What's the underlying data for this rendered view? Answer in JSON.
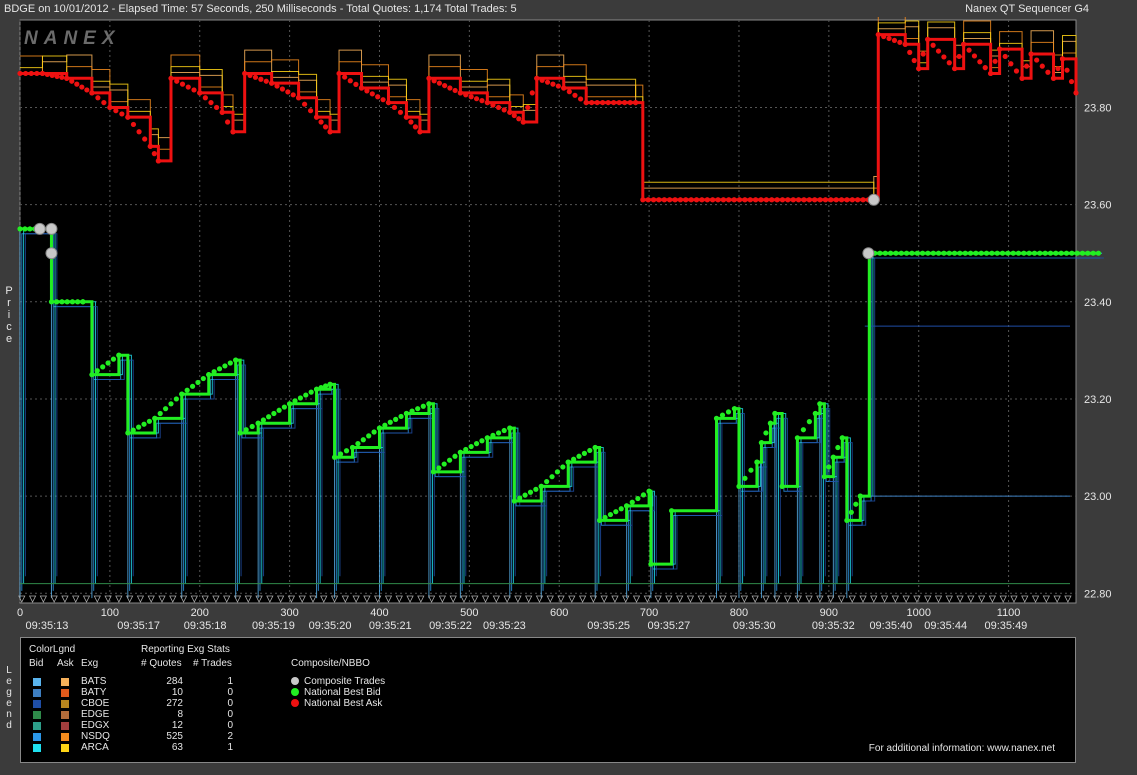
{
  "header": {
    "left": "BDGE on 10/01/2012  -  Elapsed Time: 57 Seconds, 250 Milliseconds  -  Total Quotes: 1,174  Total Trades: 5",
    "right": "Nanex QT Sequencer G4"
  },
  "watermark": "NANEX",
  "y_axis_title": "Price",
  "legend_axis_title": "Legend",
  "chart_data": {
    "type": "line",
    "xlim": [
      0,
      1175
    ],
    "ylim": [
      22.78,
      23.98
    ],
    "x_ticks": [
      0,
      100,
      200,
      300,
      400,
      500,
      600,
      700,
      800,
      900,
      1000,
      1100
    ],
    "y_ticks": [
      22.8,
      23.0,
      23.2,
      23.4,
      23.6,
      23.8
    ],
    "y_tick_labels": [
      "22.80",
      "23.00",
      "23.20",
      "23.40",
      "23.60",
      "23.80"
    ],
    "time_labels": [
      {
        "x": 30,
        "label": "09:35:13"
      },
      {
        "x": 132,
        "label": "09:35:17"
      },
      {
        "x": 206,
        "label": "09:35:18"
      },
      {
        "x": 282,
        "label": "09:35:19"
      },
      {
        "x": 345,
        "label": "09:35:20"
      },
      {
        "x": 412,
        "label": "09:35:21"
      },
      {
        "x": 479,
        "label": "09:35:22"
      },
      {
        "x": 539,
        "label": "09:35:23"
      },
      {
        "x": 655,
        "label": "09:35:25"
      },
      {
        "x": 722,
        "label": "09:35:27"
      },
      {
        "x": 817,
        "label": "09:35:30"
      },
      {
        "x": 905,
        "label": "09:35:32"
      },
      {
        "x": 969,
        "label": "09:35:40"
      },
      {
        "x": 1030,
        "label": "09:35:44"
      },
      {
        "x": 1097,
        "label": "09:35:49"
      }
    ],
    "grid": true,
    "national_best_ask": [
      [
        0,
        23.87
      ],
      [
        25,
        23.87
      ],
      [
        52,
        23.86
      ],
      [
        80,
        23.83
      ],
      [
        100,
        23.8
      ],
      [
        120,
        23.78
      ],
      [
        145,
        23.72
      ],
      [
        154,
        23.69
      ],
      [
        168,
        23.86
      ],
      [
        200,
        23.83
      ],
      [
        225,
        23.79
      ],
      [
        237,
        23.75
      ],
      [
        250,
        23.87
      ],
      [
        280,
        23.85
      ],
      [
        310,
        23.82
      ],
      [
        330,
        23.78
      ],
      [
        345,
        23.75
      ],
      [
        355,
        23.87
      ],
      [
        380,
        23.84
      ],
      [
        410,
        23.81
      ],
      [
        430,
        23.78
      ],
      [
        445,
        23.75
      ],
      [
        455,
        23.86
      ],
      [
        490,
        23.83
      ],
      [
        520,
        23.81
      ],
      [
        545,
        23.79
      ],
      [
        560,
        23.77
      ],
      [
        575,
        23.86
      ],
      [
        605,
        23.84
      ],
      [
        630,
        23.81
      ],
      [
        685,
        23.81
      ],
      [
        693,
        23.61
      ],
      [
        950,
        23.61
      ],
      [
        955,
        23.95
      ],
      [
        985,
        23.93
      ],
      [
        1000,
        23.88
      ],
      [
        1010,
        23.94
      ],
      [
        1040,
        23.88
      ],
      [
        1050,
        23.93
      ],
      [
        1080,
        23.87
      ],
      [
        1090,
        23.92
      ],
      [
        1115,
        23.86
      ],
      [
        1125,
        23.91
      ],
      [
        1150,
        23.86
      ],
      [
        1160,
        23.9
      ],
      [
        1175,
        23.83
      ]
    ],
    "national_best_bid": [
      [
        0,
        23.55
      ],
      [
        22,
        23.55
      ],
      [
        35,
        23.4
      ],
      [
        70,
        23.4
      ],
      [
        80,
        23.25
      ],
      [
        110,
        23.29
      ],
      [
        120,
        23.13
      ],
      [
        150,
        23.16
      ],
      [
        180,
        23.21
      ],
      [
        210,
        23.25
      ],
      [
        240,
        23.28
      ],
      [
        245,
        23.13
      ],
      [
        265,
        23.15
      ],
      [
        300,
        23.19
      ],
      [
        330,
        23.22
      ],
      [
        345,
        23.23
      ],
      [
        350,
        23.08
      ],
      [
        370,
        23.1
      ],
      [
        400,
        23.14
      ],
      [
        430,
        23.17
      ],
      [
        455,
        23.19
      ],
      [
        460,
        23.05
      ],
      [
        490,
        23.09
      ],
      [
        520,
        23.12
      ],
      [
        545,
        23.14
      ],
      [
        550,
        22.99
      ],
      [
        580,
        23.02
      ],
      [
        610,
        23.07
      ],
      [
        640,
        23.1
      ],
      [
        645,
        22.95
      ],
      [
        675,
        22.98
      ],
      [
        700,
        23.01
      ],
      [
        702,
        22.86
      ],
      [
        725,
        22.97
      ],
      [
        775,
        23.16
      ],
      [
        795,
        23.18
      ],
      [
        800,
        23.02
      ],
      [
        820,
        23.07
      ],
      [
        825,
        23.11
      ],
      [
        835,
        23.15
      ],
      [
        840,
        23.17
      ],
      [
        848,
        23.02
      ],
      [
        865,
        23.12
      ],
      [
        885,
        23.17
      ],
      [
        890,
        23.19
      ],
      [
        895,
        23.04
      ],
      [
        905,
        23.08
      ],
      [
        915,
        23.12
      ],
      [
        920,
        22.95
      ],
      [
        935,
        23.0
      ],
      [
        945,
        23.5
      ],
      [
        1200,
        23.5
      ]
    ],
    "composite_trades": [
      [
        22,
        23.55
      ],
      [
        35,
        23.55
      ],
      [
        35,
        23.5
      ],
      [
        950,
        23.61
      ],
      [
        944,
        23.5
      ]
    ],
    "exchange_legend_columns": [
      "Bid",
      "Ask",
      "Exg",
      "# Quotes",
      "# Trades"
    ],
    "exchanges": [
      {
        "name": "BATS",
        "bid_color": "#5ab4ee",
        "ask_color": "#f7b15a",
        "quotes": "284",
        "trades": "1"
      },
      {
        "name": "BATY",
        "bid_color": "#3e7fc1",
        "ask_color": "#e05a1c",
        "quotes": "10",
        "trades": "0"
      },
      {
        "name": "CBOE",
        "bid_color": "#1f4ea6",
        "ask_color": "#b9861e",
        "quotes": "272",
        "trades": "0"
      },
      {
        "name": "EDGE",
        "bid_color": "#2f8a4a",
        "ask_color": "#b36c3a",
        "quotes": "8",
        "trades": "0"
      },
      {
        "name": "EDGX",
        "bid_color": "#2d9e8a",
        "ask_color": "#a13e3e",
        "quotes": "12",
        "trades": "0"
      },
      {
        "name": "NSDQ",
        "bid_color": "#2b97e8",
        "ask_color": "#f28b1d",
        "quotes": "525",
        "trades": "2"
      },
      {
        "name": "ARCA",
        "bid_color": "#1fe0f0",
        "ask_color": "#ffd515",
        "quotes": "63",
        "trades": "1"
      }
    ],
    "composite_legend": [
      {
        "label": "Composite Trades",
        "color": "#c8c8c8"
      },
      {
        "label": "National Best Bid",
        "color": "#22ee22"
      },
      {
        "label": "National Best Ask",
        "color": "#ee1111"
      }
    ]
  },
  "legend": {
    "color_title": "ColorLgnd",
    "stats_title": "Reporting Exg Stats",
    "composite_title": "Composite/NBBO",
    "info": "For additional information: www.nanex.net"
  }
}
